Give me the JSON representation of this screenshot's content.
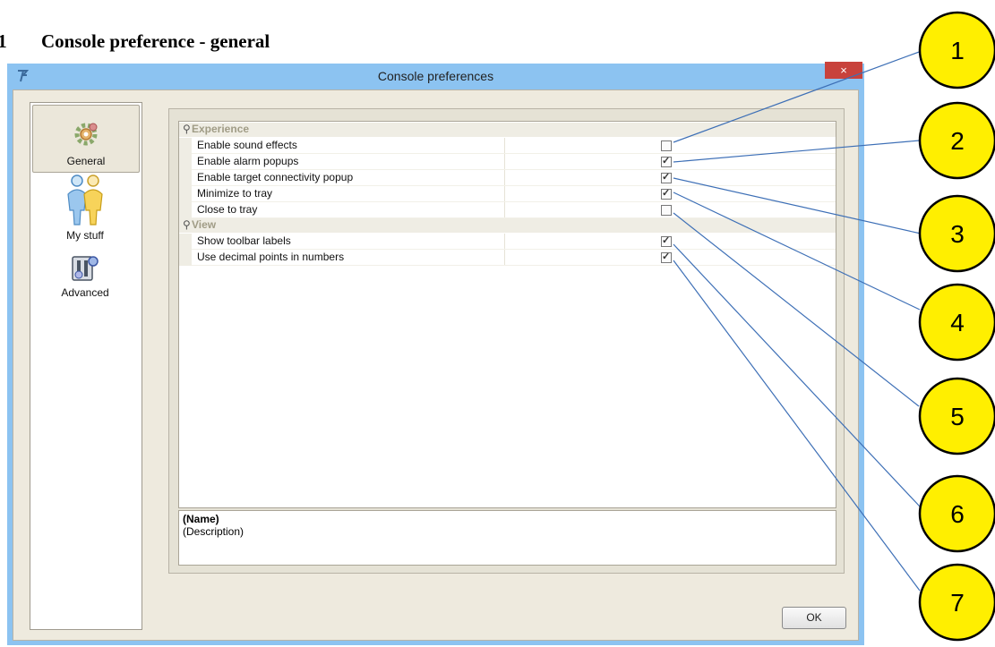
{
  "document": {
    "section_number": ".1",
    "section_title": "Console preference - general"
  },
  "window": {
    "title": "Console preferences",
    "close_label": "×"
  },
  "categories": [
    {
      "label": "General",
      "icon": "gear-icon",
      "selected": true
    },
    {
      "label": "My stuff",
      "icon": "users-icon",
      "selected": false
    },
    {
      "label": "Advanced",
      "icon": "advanced-settings-icon",
      "selected": false
    }
  ],
  "groups": [
    {
      "label": "Experience",
      "properties": [
        {
          "name": "Enable sound effects",
          "checked": false
        },
        {
          "name": "Enable alarm popups",
          "checked": true
        },
        {
          "name": "Enable target connectivity popup",
          "checked": true
        },
        {
          "name": "Minimize to tray",
          "checked": true
        },
        {
          "name": "Close to tray",
          "checked": false
        }
      ]
    },
    {
      "label": "View",
      "properties": [
        {
          "name": "Show toolbar labels",
          "checked": true
        },
        {
          "name": "Use decimal points in numbers",
          "checked": true
        }
      ]
    }
  ],
  "description": {
    "name": "(Name)",
    "text": "(Description)"
  },
  "buttons": {
    "ok_label": "OK"
  },
  "callouts": [
    "1",
    "2",
    "3",
    "4",
    "5",
    "6",
    "7"
  ],
  "colors": {
    "callout_fill": "#ffef00",
    "leader_line": "#3d6fb6",
    "title_bar": "#8cc3f1",
    "close_button": "#c8423c"
  }
}
